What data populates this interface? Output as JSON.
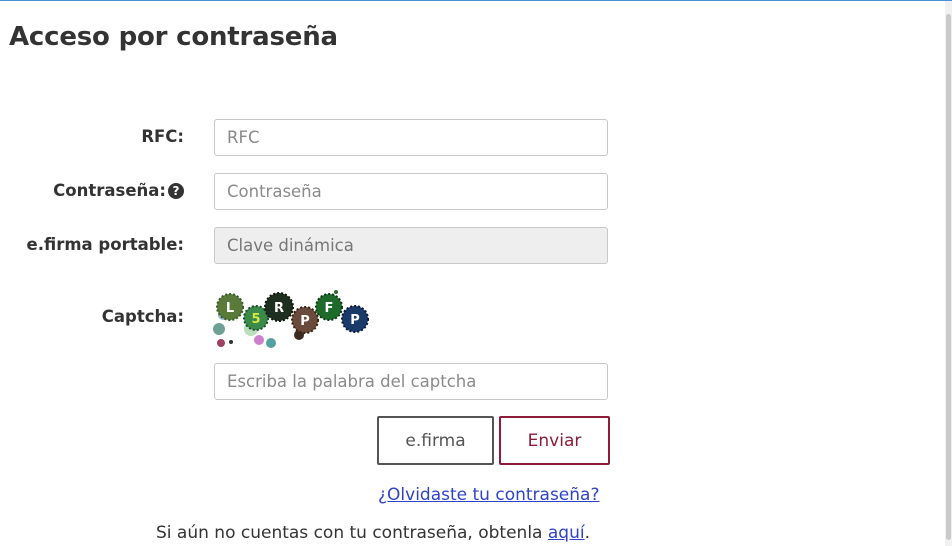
{
  "page": {
    "title": "Acceso por contraseña"
  },
  "form": {
    "rfc": {
      "label": "RFC:",
      "placeholder": "RFC",
      "value": ""
    },
    "password": {
      "label": "Contraseña:",
      "placeholder": "Contraseña",
      "value": "",
      "help_icon": "question-circle-icon"
    },
    "efirma_portable": {
      "label": "e.firma portable:",
      "placeholder": "Clave dinámica",
      "value": ""
    },
    "captcha": {
      "label": "Captcha:",
      "placeholder": "Escriba la palabra del captcha",
      "value": "",
      "characters": [
        "L",
        "5",
        "R",
        "P",
        "F",
        "P"
      ]
    }
  },
  "buttons": {
    "efirma": "e.firma",
    "enviar": "Enviar"
  },
  "links": {
    "forgot_password": "¿Olvidaste tu contraseña?",
    "signup_text": "Si aún no cuentas con tu contraseña, obtenla ",
    "signup_link": "aquí",
    "signup_suffix": "."
  },
  "colors": {
    "primary_button": "#8c1c3a",
    "link": "#2f43c8",
    "disabled_field": "#eeeeee"
  }
}
